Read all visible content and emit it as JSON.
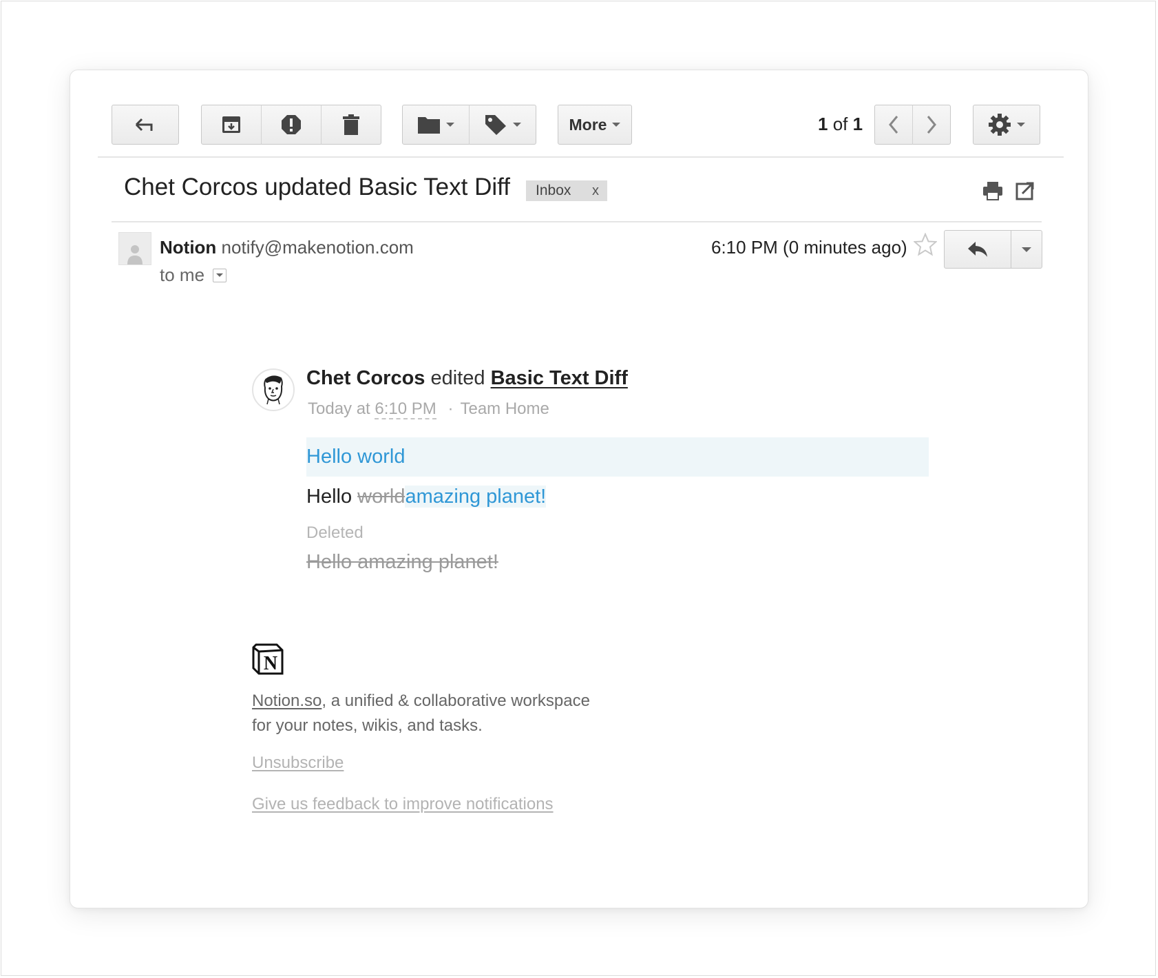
{
  "toolbar": {
    "more_label": "More",
    "pager": {
      "current": "1",
      "of": "of",
      "total": "1"
    }
  },
  "message": {
    "subject": "Chet Corcos updated Basic Text Diff",
    "label_chip": "Inbox",
    "label_remove": "x",
    "sender_name": "Notion",
    "sender_email": "notify@makenotion.com",
    "recipient": "to me",
    "time": "6:10 PM (0 minutes ago)"
  },
  "notification": {
    "editor": "Chet Corcos",
    "action": "edited",
    "page": "Basic Text Diff",
    "meta_prefix": "Today at",
    "meta_time": "6:10 PM",
    "meta_separator": "·",
    "workspace": "Team Home",
    "added_text": "Hello world",
    "diff": {
      "kept": "Hello ",
      "removed": "world",
      "inserted": "amazing planet!"
    },
    "deleted_label": "Deleted",
    "deleted_text": "Hello amazing planet!"
  },
  "footer": {
    "link": "Notion.so",
    "line1_rest": ", a unified & collaborative workspace",
    "line2": "for your notes, wikis, and tasks.",
    "unsubscribe": "Unsubscribe",
    "feedback": "Give us feedback to improve notifications"
  },
  "colors": {
    "accent_blue": "#2f97d6",
    "added_bg": "#eef6f9",
    "muted": "#a9a9a9"
  },
  "icons": [
    "back-arrow-icon",
    "archive-icon",
    "spam-icon",
    "trash-icon",
    "folder-icon",
    "tag-icon",
    "chevron-left-icon",
    "chevron-right-icon",
    "gear-icon",
    "print-icon",
    "open-new-window-icon",
    "person-icon",
    "star-icon",
    "reply-icon",
    "caret-down-icon",
    "notion-logo-icon"
  ]
}
